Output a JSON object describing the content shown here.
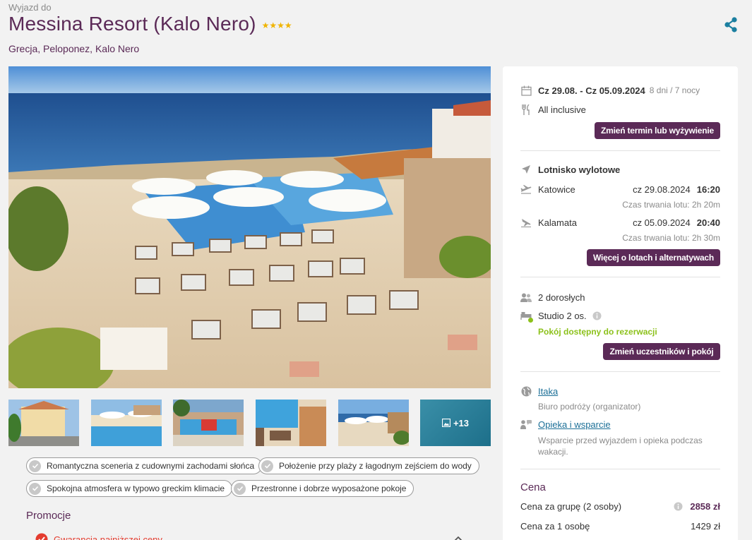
{
  "header": {
    "kicker": "Wyjazd do",
    "title": "Messina Resort (Kalo Nero)",
    "stars": "★★★★",
    "location": "Grecja, Peloponez, Kalo Nero",
    "share_icon": "share-icon"
  },
  "gallery": {
    "more_label": "+13"
  },
  "features": [
    "Romantyczna sceneria z cudownymi zachodami słońca",
    "Położenie przy plaży z łagodnym zejściem do wody",
    "Spokojna atmosfera w typowo greckim klimacie",
    "Przestronne i dobrze wyposażone pokoje"
  ],
  "promotions": {
    "title": "Promocje",
    "item": "Gwarancja najniższej ceny"
  },
  "booking": {
    "dates": "Cz 29.08. - Cz 05.09.2024",
    "duration": "8 dni / 7 nocy",
    "board": "All inclusive",
    "change_term_button": "Zmień termin lub wyżywienie",
    "airport_label": "Lotnisko wylotowe",
    "flights": [
      {
        "city": "Katowice",
        "date": "cz 29.08.2024",
        "time": "16:20",
        "duration": "Czas trwania lotu: 2h 20m"
      },
      {
        "city": "Kalamata",
        "date": "cz 05.09.2024",
        "time": "20:40",
        "duration": "Czas trwania lotu: 2h 30m"
      }
    ],
    "flights_button": "Więcej o lotach i alternatywach",
    "travellers": "2 dorosłych",
    "room": "Studio 2 os.",
    "room_status": "Pokój dostępny do rezerwacji",
    "change_room_button": "Zmień uczestników i pokój",
    "organizer": "Itaka",
    "organizer_note": "Biuro podróży (organizator)",
    "support_link": "Opieka i wsparcie",
    "support_note": "Wsparcie przed wyjazdem i opieka podczas wakacji."
  },
  "price": {
    "title": "Cena",
    "group_label": "Cena za grupę (2 osoby)",
    "group_value": "2858 zł",
    "person_label": "Cena za 1 osobę",
    "person_value": "1429 zł"
  },
  "colors": {
    "brand": "#5b2a57",
    "available": "#8cc11a",
    "link": "#1b6f97",
    "share": "#1b7fa0"
  }
}
